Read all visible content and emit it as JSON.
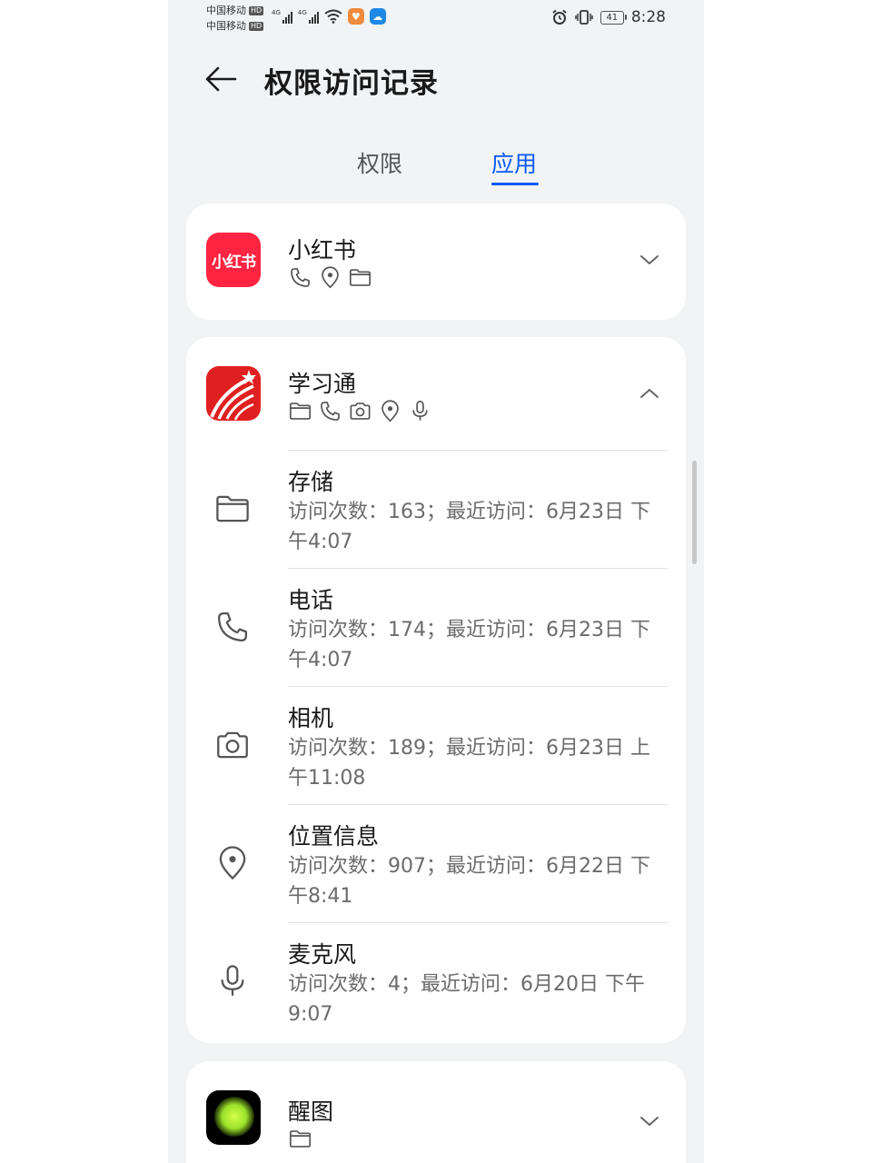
{
  "status_bar": {
    "carrier1": "中国移动",
    "carrier2": "中国移动",
    "hd": "HD",
    "net1": "4G",
    "net2": "4G",
    "battery": "41",
    "time": "8:28"
  },
  "header": {
    "title": "权限访问记录"
  },
  "tabs": [
    {
      "label": "权限",
      "active": false
    },
    {
      "label": "应用",
      "active": true
    }
  ],
  "apps": [
    {
      "name": "小红书",
      "icon_text": "小红书",
      "icon_color": "#ff2442",
      "permission_icons": [
        "phone-icon",
        "location-icon",
        "folder-icon"
      ],
      "expanded": false
    },
    {
      "name": "学习通",
      "icon_color": "#e02020",
      "permission_icons": [
        "folder-icon",
        "phone-icon",
        "camera-icon",
        "location-icon",
        "microphone-icon"
      ],
      "expanded": true,
      "permissions": [
        {
          "icon": "folder-icon",
          "title": "存储",
          "detail": "访问次数：163；最近访问：6月23日 下午4:07"
        },
        {
          "icon": "phone-icon",
          "title": "电话",
          "detail": "访问次数：174；最近访问：6月23日 下午4:07"
        },
        {
          "icon": "camera-icon",
          "title": "相机",
          "detail": "访问次数：189；最近访问：6月23日 上午11:08"
        },
        {
          "icon": "location-icon",
          "title": "位置信息",
          "detail": "访问次数：907；最近访问：6月22日 下午8:41"
        },
        {
          "icon": "microphone-icon",
          "title": "麦克风",
          "detail": "访问次数：4；最近访问：6月20日 下午9:07"
        }
      ]
    },
    {
      "name": "醒图",
      "icon_color": "#b6f23c",
      "permission_icons": [
        "folder-icon"
      ],
      "expanded": false
    }
  ],
  "colors": {
    "accent": "#0a59f7",
    "background": "#f1f3f5",
    "card": "#ffffff"
  }
}
